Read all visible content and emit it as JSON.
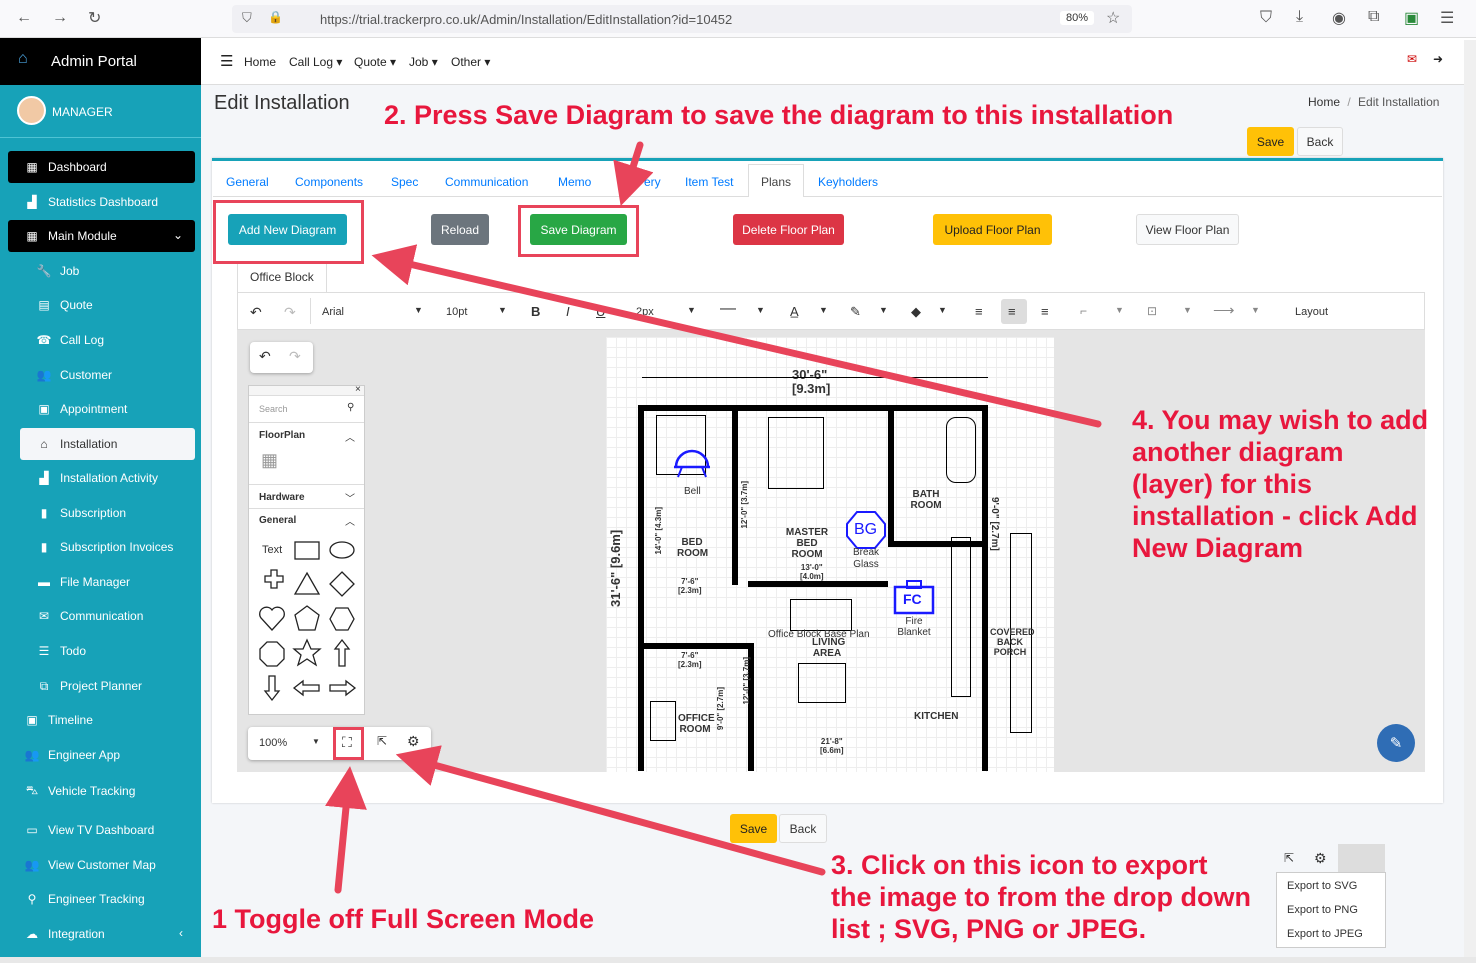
{
  "browser": {
    "url": "https://trial.trackerpro.co.uk/Admin/Installation/EditInstallation?id=10452",
    "zoom": "80%"
  },
  "brand": {
    "title": "Admin Portal"
  },
  "user": {
    "name": "MANAGER"
  },
  "sidebar": {
    "items": [
      {
        "label": "Dashboard",
        "icon": "grid-icon"
      },
      {
        "label": "Statistics Dashboard",
        "icon": "chart-icon"
      },
      {
        "label": "Main Module",
        "icon": "grid-icon"
      },
      {
        "label": "Job",
        "icon": "wrench-icon"
      },
      {
        "label": "Quote",
        "icon": "calculator-icon"
      },
      {
        "label": "Call Log",
        "icon": "user-phone-icon"
      },
      {
        "label": "Customer",
        "icon": "users-icon"
      },
      {
        "label": "Appointment",
        "icon": "calendar-icon"
      },
      {
        "label": "Installation",
        "icon": "home-icon"
      },
      {
        "label": "Installation Activity",
        "icon": "chart-icon"
      },
      {
        "label": "Subscription",
        "icon": "file-icon"
      },
      {
        "label": "Subscription Invoices",
        "icon": "file-icon"
      },
      {
        "label": "File Manager",
        "icon": "folder-icon"
      },
      {
        "label": "Communication",
        "icon": "envelope-icon"
      },
      {
        "label": "Todo",
        "icon": "list-icon"
      },
      {
        "label": "Project Planner",
        "icon": "sitemap-icon"
      },
      {
        "label": "Timeline",
        "icon": "calendar-icon"
      },
      {
        "label": "Engineer App",
        "icon": "users-gear-icon"
      },
      {
        "label": "Vehicle Tracking",
        "icon": "driver-icon"
      },
      {
        "label": "View TV Dashboard",
        "icon": "tv-icon"
      },
      {
        "label": "View Customer Map",
        "icon": "users-icon"
      },
      {
        "label": "Engineer Tracking",
        "icon": "pin-icon"
      },
      {
        "label": "Integration",
        "icon": "cloud-icon"
      }
    ]
  },
  "topnav": {
    "home": "Home",
    "call_log": "Call Log",
    "quote": "Quote",
    "job": "Job",
    "other": "Other"
  },
  "page": {
    "title": "Edit Installation",
    "breadcrumb_home": "Home",
    "breadcrumb_sep": "/",
    "breadcrumb_current": "Edit Installation",
    "save": "Save",
    "back": "Back"
  },
  "tabs": [
    "General",
    "Components",
    "Spec",
    "Communication",
    "Memo",
    "ery",
    "Item Test",
    "Plans",
    "Keyholders"
  ],
  "plan_buttons": {
    "add": "Add New Diagram",
    "reload": "Reload",
    "save": "Save Diagram",
    "delete": "Delete Floor Plan",
    "upload": "Upload Floor Plan",
    "view": "View Floor Plan"
  },
  "diagram_tab": "Office Block",
  "toolbar": {
    "font": "Arial",
    "size": "10pt",
    "stroke": "2px",
    "layout": "Layout",
    "bold": "B",
    "italic": "I"
  },
  "shapes_panel": {
    "search": "Search",
    "floorplan": "FloorPlan",
    "hardware": "Hardware",
    "general": "General",
    "text_shape": "Text"
  },
  "zoom": "100%",
  "floorplan": {
    "dim_top": "30'-6\"",
    "dim_top_m": "[9.3m]",
    "dim_left": "31'-6\"",
    "dim_left_m": "[9.6m]",
    "dim_right": "9'-0\"",
    "dim_right_m": "[2.7m]",
    "bed_dim": "14'-0\"",
    "bed_dim_m": "[4.3m]",
    "master_side_dim": "12'-0\"",
    "master_side_dim_m": "[3.7m]",
    "bed_closet_dim": "7'-6\"",
    "bed_closet_dim_m": "[2.3m]",
    "office_top_dim": "7'-6\"",
    "office_top_dim_m": "[2.3m]",
    "living_side_dim": "12'-0\"",
    "living_side_dim_m": "[3.7m]",
    "office_side_dim": "9'-0\"",
    "office_side_dim_m": "[2.7m]",
    "master_dim": "13'-0\"",
    "master_dim_m": "[4.0m]",
    "kitchen_dim": "21'-8\"",
    "kitchen_dim_m": "[6.6m]",
    "rooms": {
      "bed": "BED ROOM",
      "master": "MASTER BED ROOM",
      "bath": "BATH ROOM",
      "living": "LIVING AREA",
      "office": "OFFICE ROOM",
      "kitchen": "KITCHEN",
      "porch": "COVERED BACK PORCH"
    },
    "bell": "Bell",
    "bg": "BG",
    "bg_label": "Break Glass",
    "fc": "FC",
    "fc_label": "Fire Blanket",
    "overlay": "Office Block Base Plan"
  },
  "export_menu": [
    "Export to SVG",
    "Export to PNG",
    "Export to JPEG"
  ],
  "annotations": {
    "a1": "1 Toggle off Full Screen Mode",
    "a2": "2. Press Save Diagram to save the diagram to this installation",
    "a3": "3. Click on this icon to export the image to from the drop down list ; SVG, PNG or JPEG.",
    "a4": "4. You may wish to add another diagram (layer) for this installation - click Add New Diagram"
  },
  "colors": {
    "accent": "#17a2b8",
    "annotation": "#e8173d"
  }
}
